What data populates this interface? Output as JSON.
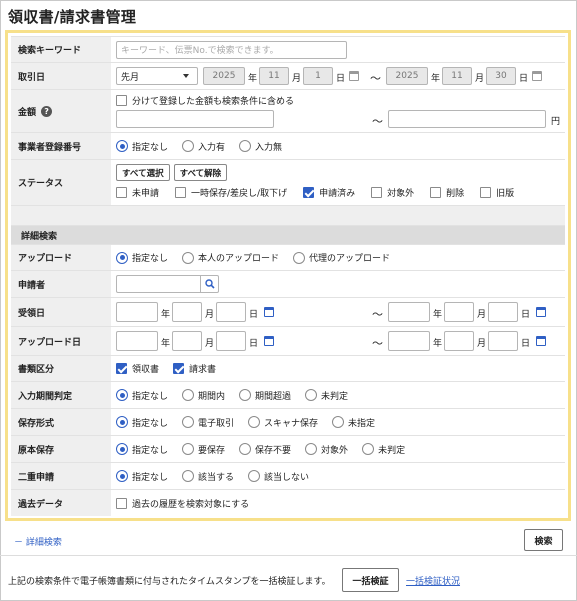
{
  "page": {
    "title": "領収書/請求書管理"
  },
  "form": {
    "keyword": {
      "label": "検索キーワード",
      "placeholder": "キーワード、伝票No.で検索できます。"
    },
    "transaction_date": {
      "label": "取引日",
      "period": "先月",
      "from": {
        "year": "2025",
        "month": "11",
        "day": "1"
      },
      "to": {
        "year": "2025",
        "month": "11",
        "day": "30"
      },
      "units": {
        "year": "年",
        "month": "月",
        "day": "日"
      },
      "tilde": "～"
    },
    "amount": {
      "label": "金額",
      "help": "?",
      "include_split_label": "分けて登録した金額も検索条件に含める",
      "unit": "円",
      "tilde": "～"
    },
    "registration_number": {
      "label": "事業者登録番号",
      "options": [
        "指定なし",
        "入力有",
        "入力無"
      ],
      "selected": "指定なし"
    },
    "status": {
      "label": "ステータス",
      "select_all": "すべて選択",
      "deselect_all": "すべて解除",
      "options": [
        "未申請",
        "一時保存/差戻し/取下げ",
        "申請済み",
        "対象外",
        "削除",
        "旧版"
      ],
      "checked": [
        "申請済み"
      ]
    }
  },
  "detail": {
    "heading": "詳細検索",
    "upload": {
      "label": "アップロード",
      "options": [
        "指定なし",
        "本人のアップロード",
        "代理のアップロード"
      ],
      "selected": "指定なし"
    },
    "applicant": {
      "label": "申請者"
    },
    "received_date": {
      "label": "受領日",
      "units": {
        "year": "年",
        "month": "月",
        "day": "日"
      },
      "tilde": "～"
    },
    "upload_date": {
      "label": "アップロード日",
      "units": {
        "year": "年",
        "month": "月",
        "day": "日"
      },
      "tilde": "～"
    },
    "doc_type": {
      "label": "書類区分",
      "options": [
        "領収書",
        "請求書"
      ],
      "checked": [
        "領収書",
        "請求書"
      ]
    },
    "input_period": {
      "label": "入力期間判定",
      "options": [
        "指定なし",
        "期間内",
        "期間超過",
        "未判定"
      ],
      "selected": "指定なし"
    },
    "storage_format": {
      "label": "保存形式",
      "options": [
        "指定なし",
        "電子取引",
        "スキャナ保存",
        "未指定"
      ],
      "selected": "指定なし"
    },
    "original_storage": {
      "label": "原本保存",
      "options": [
        "指定なし",
        "要保存",
        "保存不要",
        "対象外",
        "未判定"
      ],
      "selected": "指定なし"
    },
    "duplicate": {
      "label": "二重申請",
      "options": [
        "指定なし",
        "該当する",
        "該当しない"
      ],
      "selected": "指定なし"
    },
    "past_data": {
      "label": "過去データ",
      "checkbox_label": "過去の履歴を検索対象にする"
    }
  },
  "footer": {
    "toggle_detail": "－ 詳細検索",
    "search_button": "検索",
    "timestamp_text": "上記の検索条件で電子帳簿書類に付与されたタイムスタンプを一括検証します。",
    "bulk_verify_button": "一括検証",
    "bulk_verify_status_link": "一括検証状況"
  },
  "colors": {
    "accent": "#2f5fc4",
    "panel_border": "#f7e08a",
    "label_bg": "#efefef"
  },
  "icons": [
    "help-icon",
    "calendar-icon",
    "search-icon",
    "chevron-down-icon"
  ]
}
